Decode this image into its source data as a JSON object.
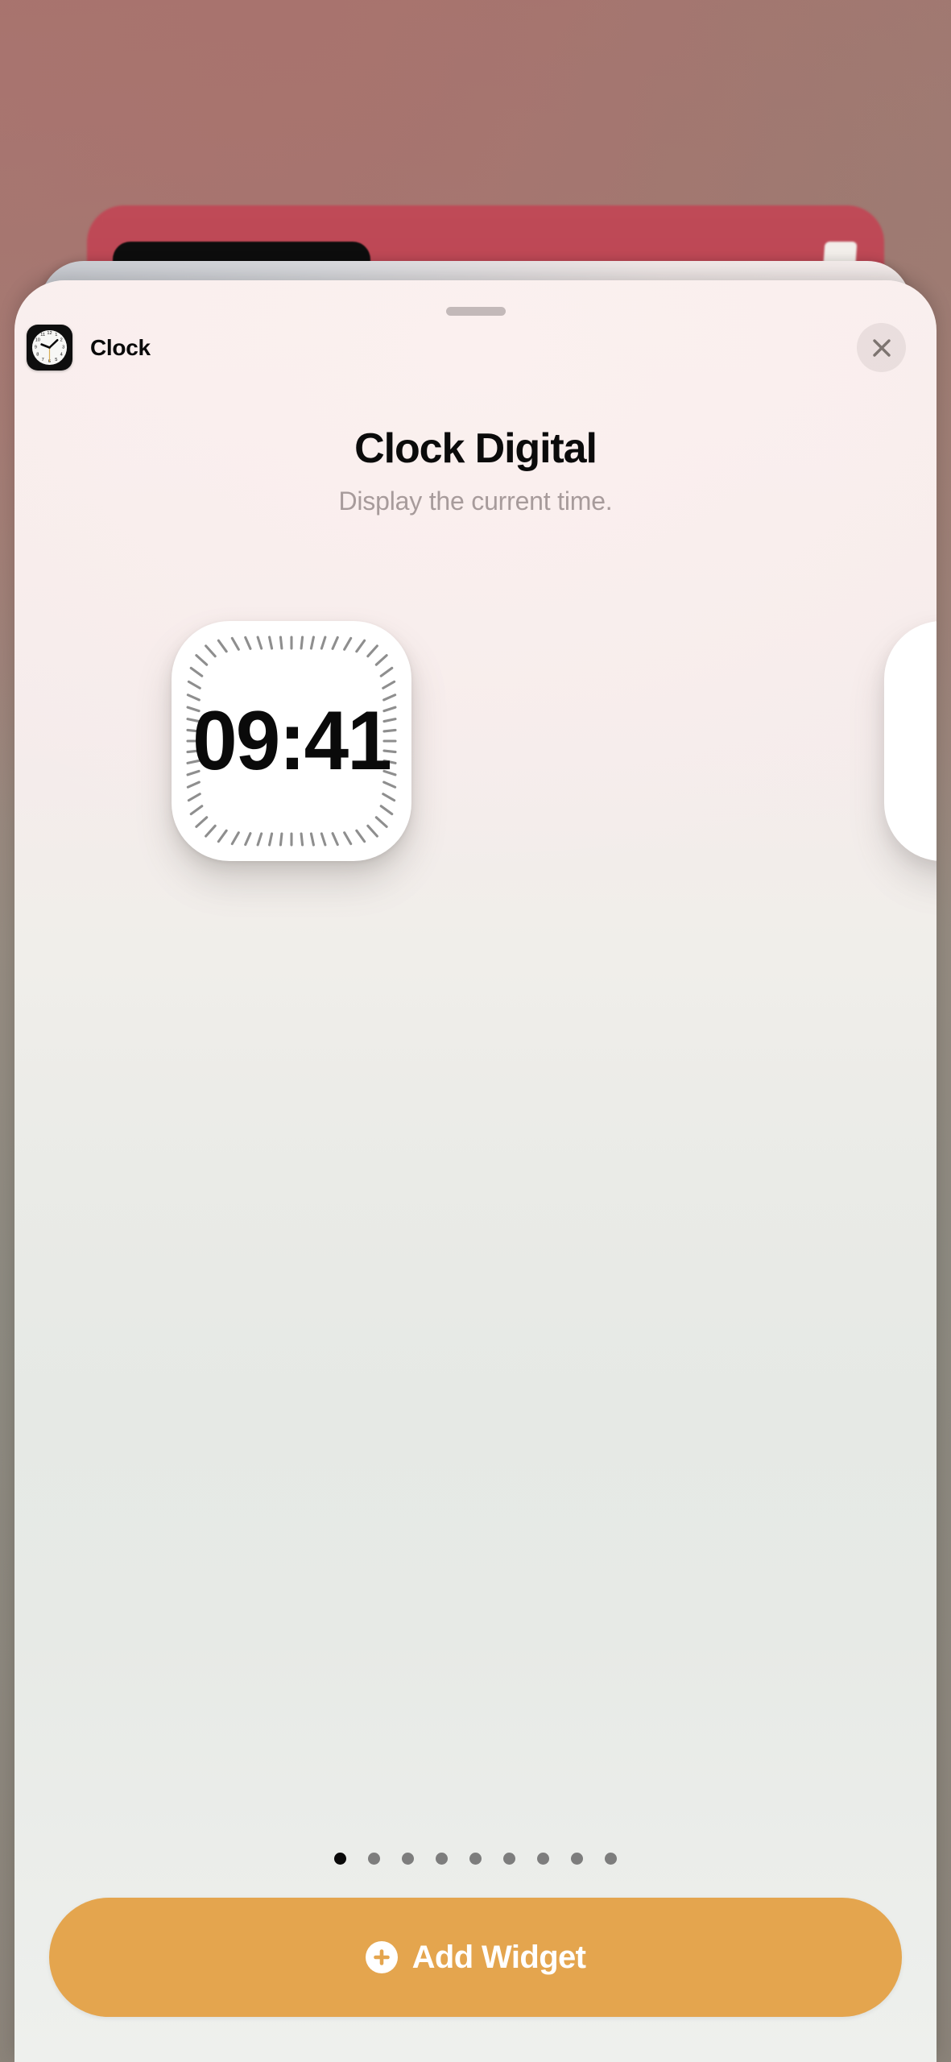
{
  "wallpaper": {
    "name": "blurred-home-screen-backdrop",
    "colors": {
      "top": "#a9746f",
      "bottom": "#8b8379",
      "card_red": "#bf4a57"
    }
  },
  "sheet": {
    "name": "widget-detail-sheet",
    "grabber_label": "drag handle",
    "gradient_top": "#f8eeed",
    "gradient_bottom": "#eef0ed"
  },
  "header": {
    "app_icon": "clock-app-icon",
    "app_name": "Clock",
    "close_icon": "close-icon",
    "close_label": "Close"
  },
  "detail": {
    "title": "Clock Digital",
    "subtitle": "Display the current time."
  },
  "widget_preview": {
    "name": "clock-digital-widget-preview",
    "time": "09:41",
    "background": "#ffffff",
    "text_color": "#0a0a0a",
    "tick_color": "#8e8e8e",
    "tick_count": 60
  },
  "pagination": {
    "total": 9,
    "active_index": 0,
    "dots": [
      {
        "active": true
      },
      {
        "active": false
      },
      {
        "active": false
      },
      {
        "active": false
      },
      {
        "active": false
      },
      {
        "active": false
      },
      {
        "active": false
      },
      {
        "active": false
      },
      {
        "active": false
      }
    ]
  },
  "actions": {
    "add_widget_label": "Add Widget",
    "add_widget_icon": "plus-circle-icon",
    "accent_color": "#e4a54e"
  }
}
